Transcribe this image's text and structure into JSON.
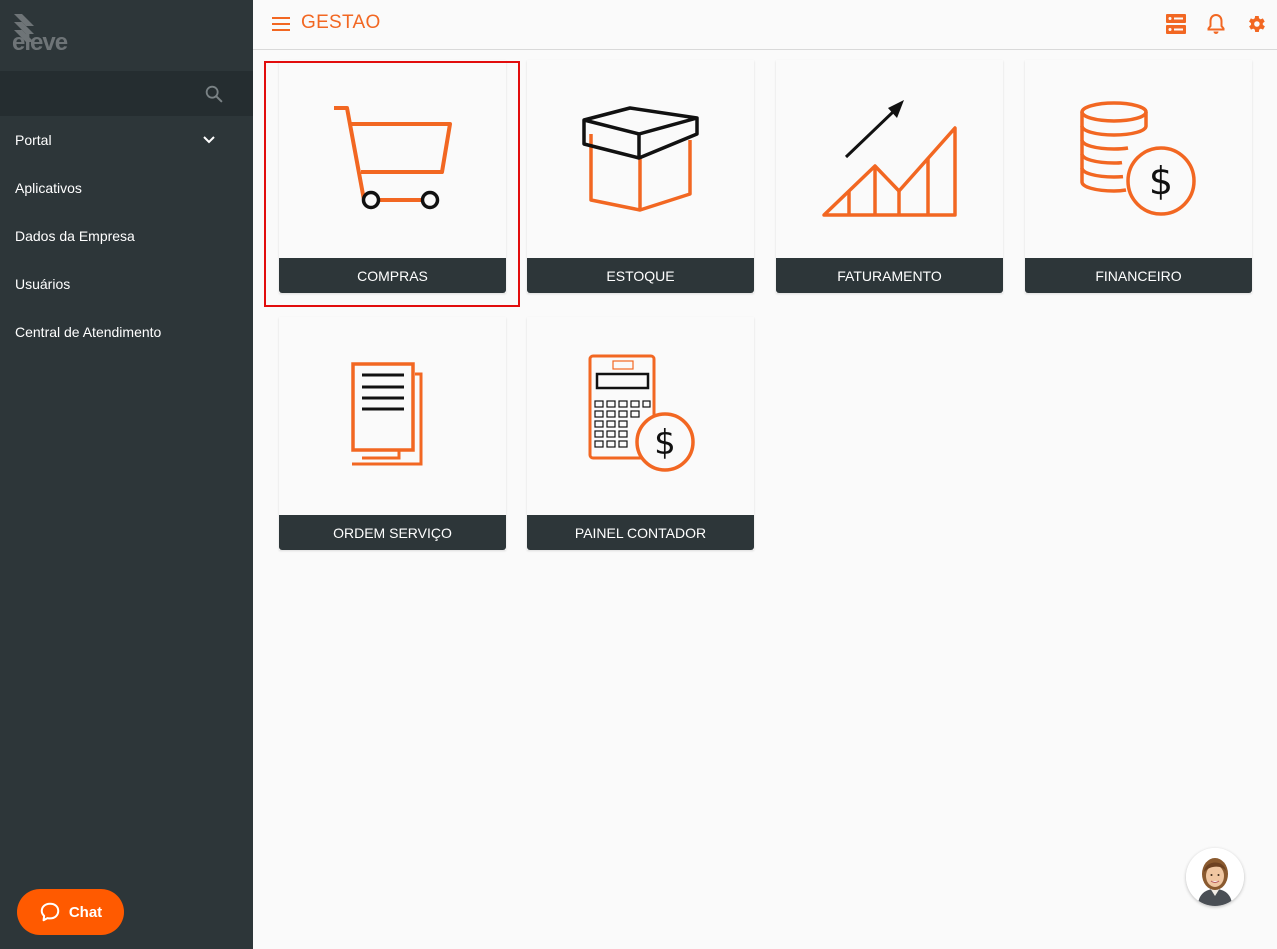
{
  "brand": {
    "logo_text": "eleve"
  },
  "colors": {
    "accent": "#f26722",
    "chat": "#ff5a00",
    "sidebar": "#2d3639",
    "highlight": "#e20d0d"
  },
  "search": {
    "placeholder": ""
  },
  "sidebar": {
    "items": [
      {
        "label": "Portal",
        "icon": "chevron-down-icon"
      },
      {
        "label": "Aplicativos"
      },
      {
        "label": "Dados da Empresa"
      },
      {
        "label": "Usuários"
      },
      {
        "label": "Central de Atendimento"
      }
    ]
  },
  "chat": {
    "label": "Chat",
    "icon": "chat-bubble-icon"
  },
  "topbar": {
    "title": "GESTAO",
    "icons": [
      "server-icon",
      "bell-icon",
      "gear-icon"
    ]
  },
  "tiles": [
    {
      "label": "COMPRAS",
      "icon": "shopping-cart-icon",
      "selected": true
    },
    {
      "label": "ESTOQUE",
      "icon": "box-icon"
    },
    {
      "label": "FATURAMENTO",
      "icon": "growth-chart-icon"
    },
    {
      "label": "FINANCEIRO",
      "icon": "coins-dollar-icon"
    },
    {
      "label": "ORDEM SERVIÇO",
      "icon": "documents-icon"
    },
    {
      "label": "PAINEL CONTADOR",
      "icon": "calculator-dollar-icon"
    }
  ]
}
